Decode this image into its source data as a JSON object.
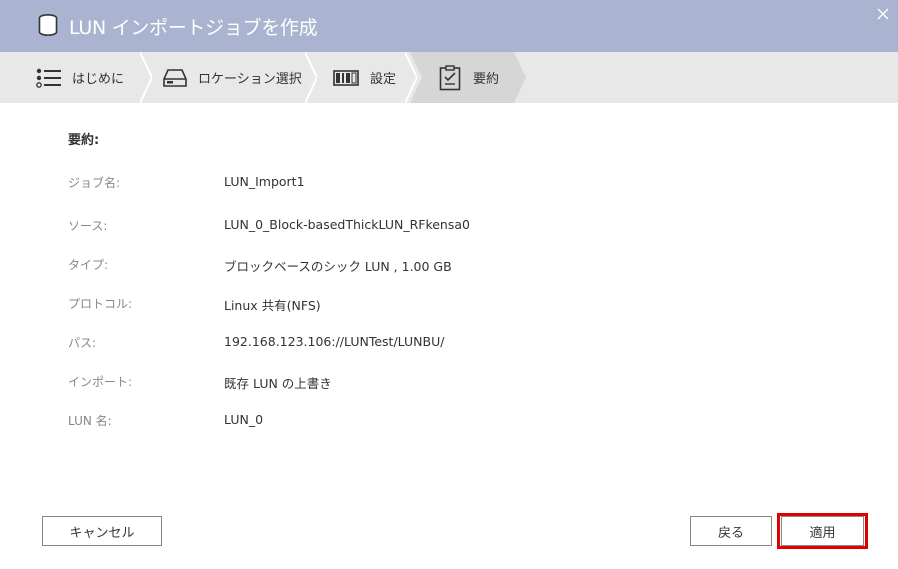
{
  "window": {
    "title": "LUN インポートジョブを作成",
    "icon": "database-icon"
  },
  "steps": [
    {
      "label": "はじめに",
      "icon": "list-icon"
    },
    {
      "label": "ロケーション選択",
      "icon": "drive-icon"
    },
    {
      "label": "設定",
      "icon": "settings-icon"
    },
    {
      "label": "要約",
      "icon": "clipboard-icon",
      "active": true
    }
  ],
  "summary": {
    "title": "要約:",
    "rows": [
      {
        "label": "ジョブ名:",
        "value": "LUN_Import1"
      },
      {
        "label": "ソース:",
        "value": "LUN_0_Block-basedThickLUN_RFkensa0"
      },
      {
        "label": "タイプ:",
        "value": "ブロックベースのシック LUN , 1.00 GB"
      },
      {
        "label": "プロトコル:",
        "value": "Linux 共有(NFS)"
      },
      {
        "label": "パス:",
        "value": "192.168.123.106://LUNTest/LUNBU/"
      },
      {
        "label": "インポート:",
        "value": "既存 LUN の上書き"
      },
      {
        "label": "LUN 名:",
        "value": "LUN_0"
      }
    ]
  },
  "buttons": {
    "cancel": "キャンセル",
    "back": "戻る",
    "apply": "適用"
  },
  "colors": {
    "titlebar": "#aab3cf",
    "steps_bg": "#e8e8e8",
    "active_step": "#d6d6d6",
    "highlight": "#e00000"
  }
}
